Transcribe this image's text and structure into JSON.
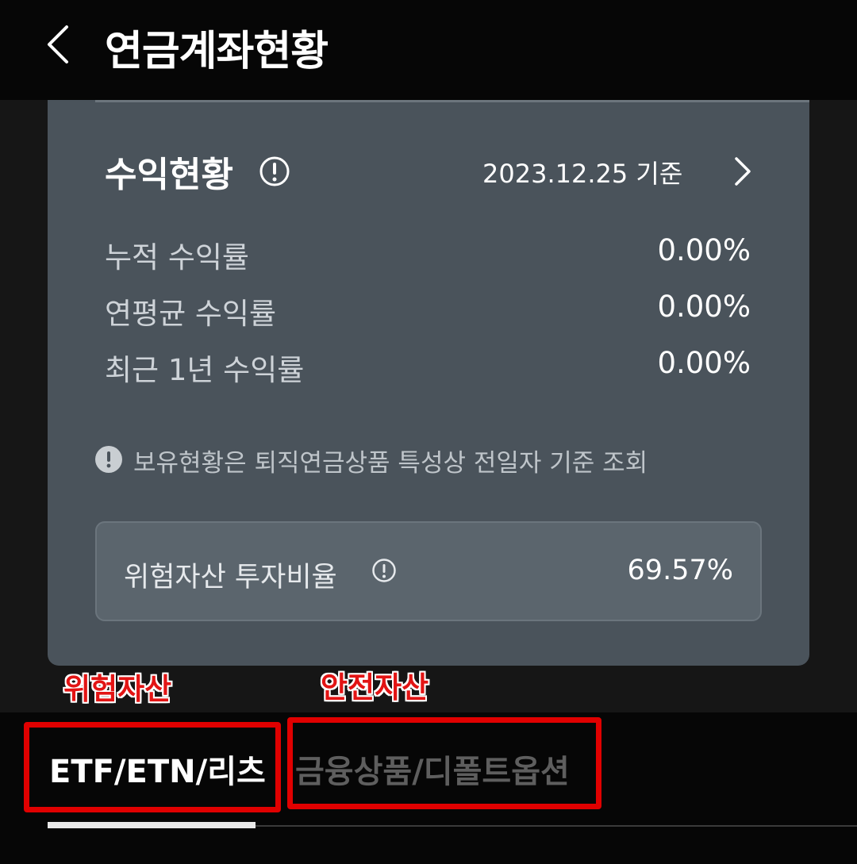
{
  "header": {
    "title": "연금계좌현황"
  },
  "profit": {
    "title": "수익현황",
    "as_of": "2023.12.25 기준",
    "rows": [
      {
        "label": "누적 수익률",
        "value": "0.00%"
      },
      {
        "label": "연평균 수익률",
        "value": "0.00%"
      },
      {
        "label": "최근 1년 수익률",
        "value": "0.00%"
      }
    ],
    "notice": "보유현황은 퇴직연금상품 특성상 전일자 기준 조회",
    "risk_ratio": {
      "label": "위험자산 투자비율",
      "value": "69.57%"
    }
  },
  "annotations": {
    "risk": "위험자산",
    "safe": "안전자산"
  },
  "tabs": [
    {
      "label": "ETF/ETN/리츠",
      "active": true
    },
    {
      "label": "금융상품/디폴트옵션",
      "active": false
    }
  ],
  "colors": {
    "annotation": "#e00000",
    "card": "#4a535b"
  }
}
